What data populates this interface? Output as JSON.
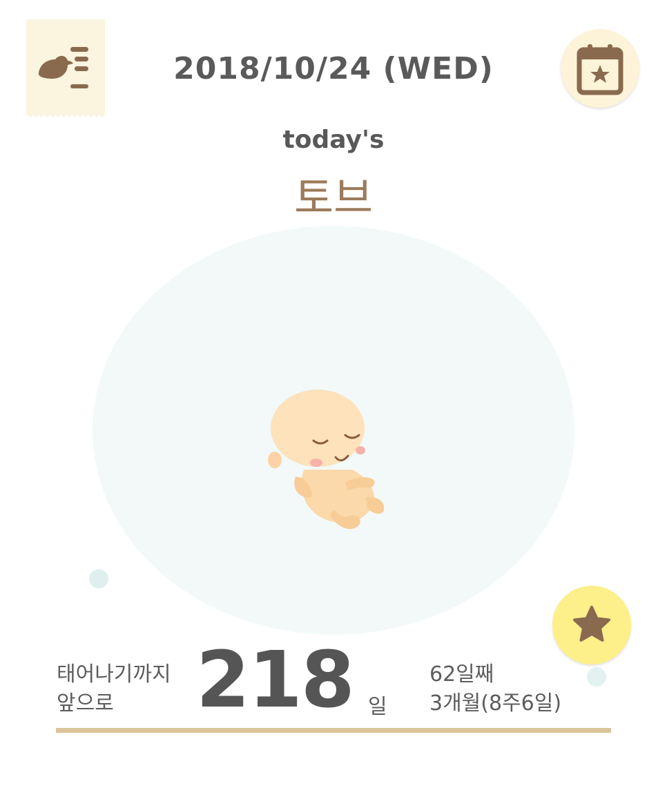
{
  "header": {
    "date": "2018/10/24 (WED)",
    "menu_icon": "bird-list-icon",
    "calendar_icon": "calendar-star-icon"
  },
  "main": {
    "todays_label": "today's",
    "baby_name": "토브",
    "illustration": "sleeping-baby-illustration",
    "favorite_icon": "star-icon"
  },
  "countdown": {
    "label_line1": "태어나기까지",
    "label_line2": "앞으로",
    "days": "218",
    "days_unit": "일",
    "day_count": "62일째",
    "pregnancy_age": "3개월(8주6일)"
  },
  "colors": {
    "brand_brown": "#9c7b5a",
    "icon_brown": "#8a6a4e",
    "tag_bg": "#fbf4de",
    "star_bg": "#fdef8a",
    "bubble_bg": "#f3f9f9",
    "progress": "#dcc49a"
  }
}
